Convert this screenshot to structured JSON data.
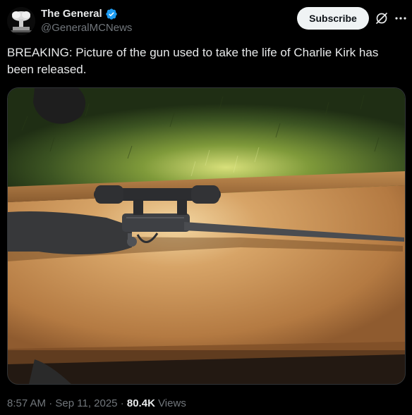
{
  "author": {
    "display_name": "The General",
    "handle": "@GeneralMCNews",
    "verified": true,
    "verified_color": "#1d9bf0"
  },
  "actions": {
    "subscribe_label": "Subscribe",
    "grok_icon": "grok-icon",
    "more_icon": "more-icon"
  },
  "post": {
    "text": "BREAKING: Picture of the gun used to take the life of Charlie Kirk has been released."
  },
  "media": {
    "kind": "photo",
    "subject": "rifle with scope on cardboard"
  },
  "meta": {
    "time": "8:57 AM",
    "separator": "·",
    "date": "Sep 11, 2025",
    "views_count": "80.4K",
    "views_label": "Views"
  },
  "colors": {
    "background": "#000000",
    "text_primary": "#e7e9ea",
    "text_secondary": "#71767b",
    "button_bg": "#eff3f4",
    "border": "#2f3336"
  }
}
